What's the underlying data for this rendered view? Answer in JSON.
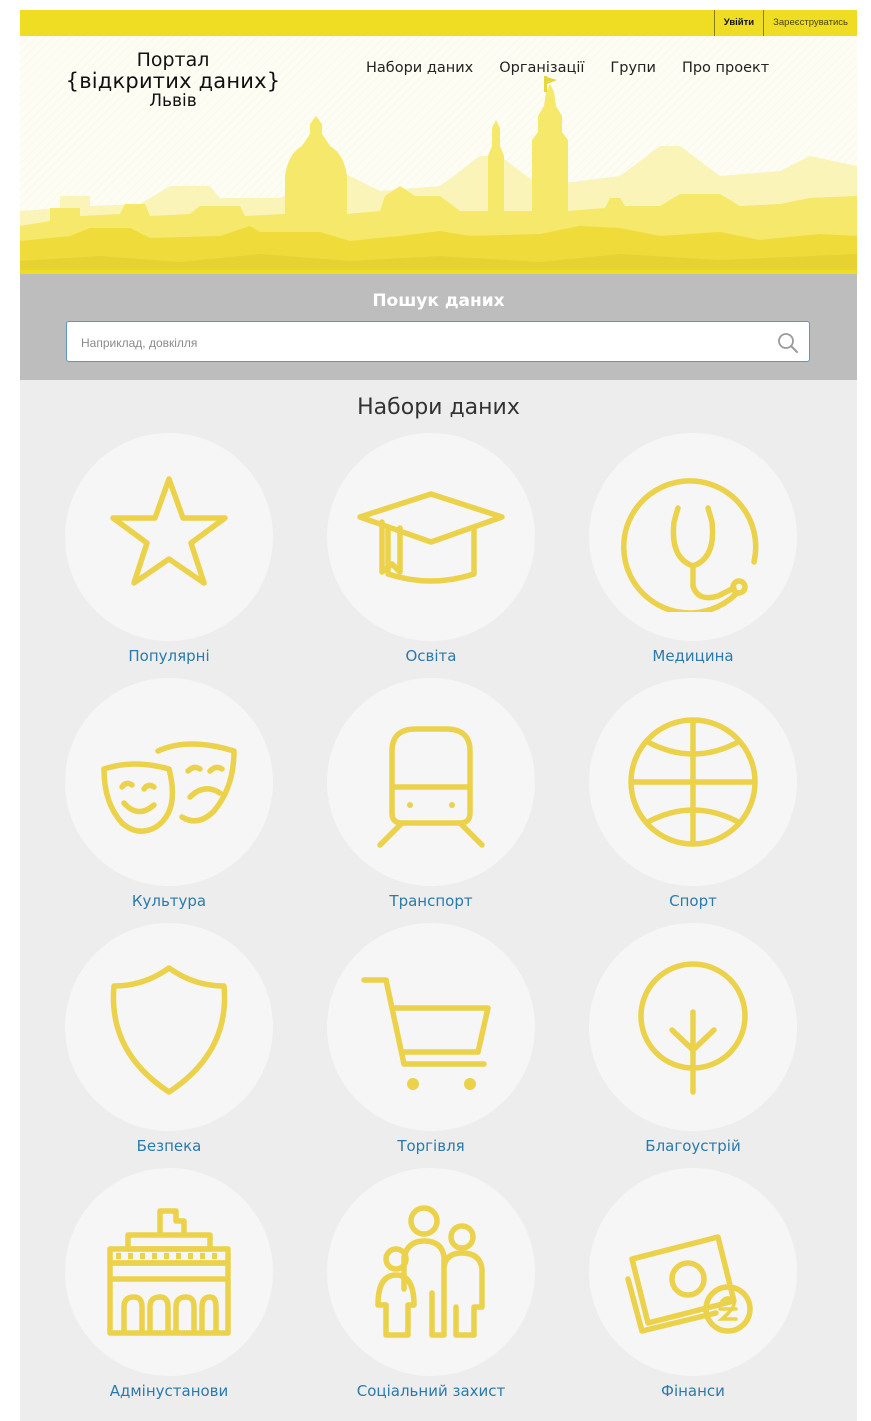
{
  "topbar": {
    "login_label": "Увійти",
    "register_label": "Зареєструватись"
  },
  "logo": {
    "line1": "Портал",
    "line2": "{відкритих даних}",
    "line3": "Львів"
  },
  "nav": {
    "items": [
      "Набори даних",
      "Організації",
      "Групи",
      "Про проект"
    ]
  },
  "search": {
    "title": "Пошук даних",
    "placeholder": "Наприклад, довкілля"
  },
  "datasets": {
    "title": "Набори даних",
    "categories": [
      {
        "label": "Популярні",
        "icon": "star-icon"
      },
      {
        "label": "Освіта",
        "icon": "graduation-cap-icon"
      },
      {
        "label": "Медицина",
        "icon": "stethoscope-icon"
      },
      {
        "label": "Культура",
        "icon": "theater-masks-icon"
      },
      {
        "label": "Транспорт",
        "icon": "train-icon"
      },
      {
        "label": "Спорт",
        "icon": "ball-icon"
      },
      {
        "label": "Безпека",
        "icon": "shield-icon"
      },
      {
        "label": "Торгівля",
        "icon": "shopping-cart-icon"
      },
      {
        "label": "Благоустрій",
        "icon": "tree-icon"
      },
      {
        "label": "Адмінустанови",
        "icon": "government-building-icon"
      },
      {
        "label": "Соціальний захист",
        "icon": "family-icon"
      },
      {
        "label": "Фінанси",
        "icon": "money-icon"
      }
    ]
  },
  "colors": {
    "accent_yellow": "#eedd22",
    "icon_yellow": "#ecd24a",
    "link_blue": "#2a7aab",
    "search_band": "#bdbdbd"
  }
}
